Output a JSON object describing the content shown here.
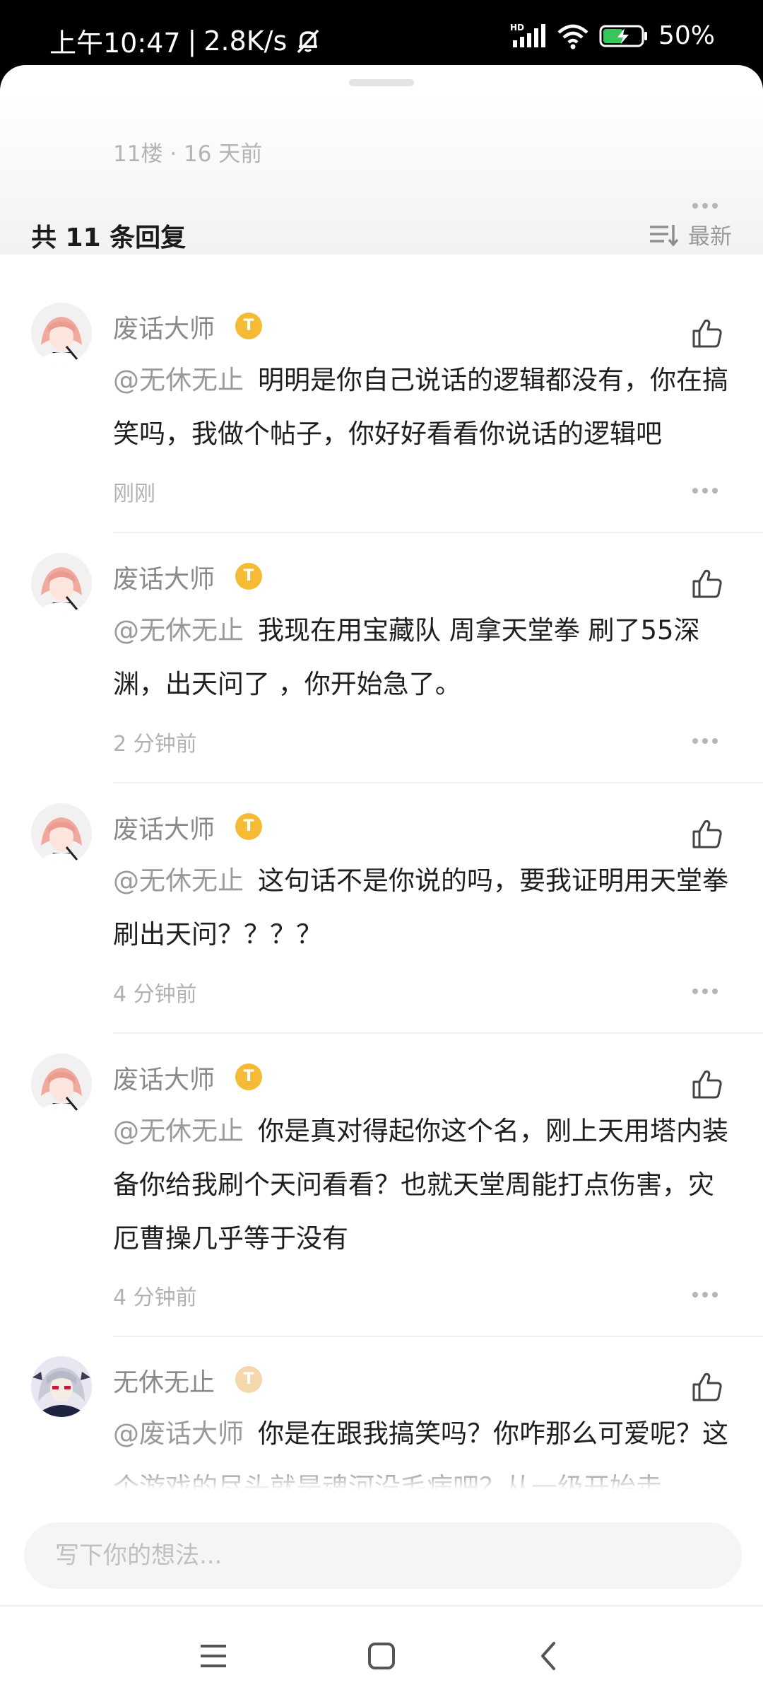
{
  "status_bar": {
    "time": "上午10:47",
    "network_speed": "2.8K/s",
    "battery": "50%",
    "signal_label": "HD"
  },
  "floor": {
    "meta": "11楼 · 16 天前"
  },
  "reply_header": {
    "title": "共 11 条回复",
    "sort_label": "最新"
  },
  "comments": [
    {
      "user": "废话大师",
      "badge": "T",
      "mention": "@无休无止",
      "text": "明明是你自己说话的逻辑都没有，你在搞笑吗，我做个帖子，你好好看看你说话的逻辑吧",
      "time": "刚刚"
    },
    {
      "user": "废话大师",
      "badge": "T",
      "mention": "@无休无止",
      "text": "我现在用宝藏队  周拿天堂拳  刷了55深渊，出天问了  ，你开始急了。",
      "time": "2 分钟前"
    },
    {
      "user": "废话大师",
      "badge": "T",
      "mention": "@无休无止",
      "text": "这句话不是你说的吗，要我证明用天堂拳刷出天问？？？？",
      "time": "4 分钟前"
    },
    {
      "user": "废话大师",
      "badge": "T",
      "mention": "@无休无止",
      "text": "你是真对得起你这个名，刚上天用塔内装备你给我刷个天问看看？也就天堂周能打点伤害，灾厄曹操几乎等于没有",
      "time": "4 分钟前"
    },
    {
      "user": "无休无止",
      "badge": "T",
      "mention": "@废话大师",
      "text": "你是在跟我搞笑吗？你咋那么可爱呢？这个游戏的尽头就是魂河没毛病吧？从一级开始走",
      "time": ""
    }
  ],
  "input": {
    "placeholder": "写下你的想法..."
  }
}
